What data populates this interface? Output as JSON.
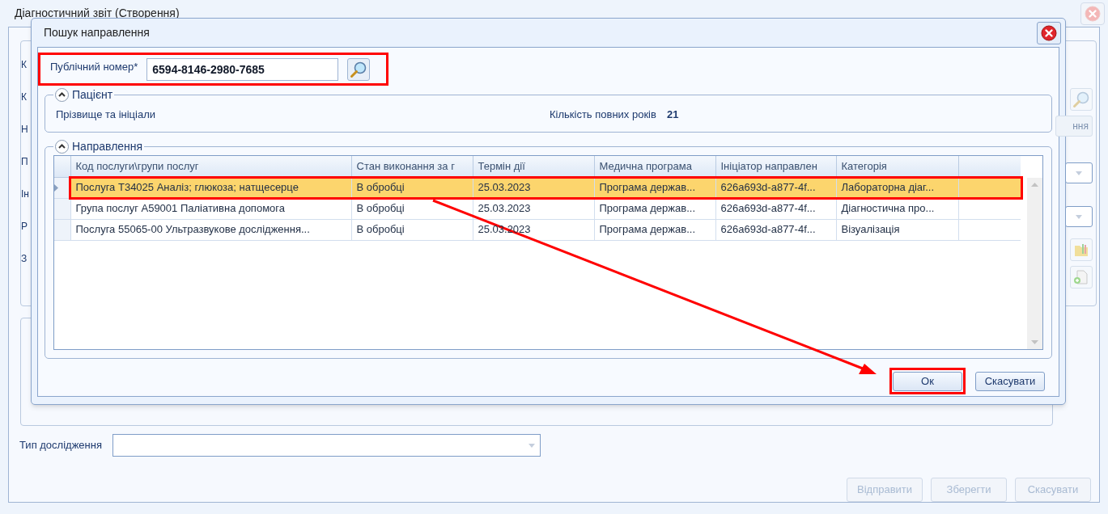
{
  "window": {
    "title": "Діагностичний звіт (Створення)",
    "form_labels": [
      "К",
      "К",
      "Н",
      "П",
      "Ін",
      "Р",
      "З"
    ],
    "hidden_button": "ння",
    "study_type": {
      "label": "Тип дослідження"
    },
    "buttons": [
      {
        "label": "Відправити",
        "disabled": true
      },
      {
        "label": "Зберегти",
        "disabled": true
      },
      {
        "label": "Скасувати",
        "disabled": true
      }
    ]
  },
  "dialog": {
    "title": "Пошук направлення",
    "public_number": {
      "label": "Публічний номер*",
      "value": "6594-8146-2980-7685",
      "highlighted": true
    },
    "patient": {
      "title": "Пацієнт",
      "expanded": true,
      "name_label": "Прізвище та ініціали",
      "age_label": "Кількість повних років",
      "age_value": "21"
    },
    "referrals": {
      "title": "Направлення",
      "expanded": true,
      "columns": [
        "Код послуги\\групи послуг",
        "Стан виконання за г",
        "Термін дії",
        "Медична програма",
        "Ініціатор направлен",
        "Категорія"
      ],
      "rows": [
        {
          "selected": true,
          "highlighted": true,
          "cells": [
            "Послуга Т34025 Аналіз; глюкоза; натщесерце",
            "В обробці",
            "25.03.2023",
            "Програма держав...",
            "626a693d-a877-4f...",
            "Лабораторна діаг..."
          ]
        },
        {
          "selected": false,
          "highlighted": false,
          "cells": [
            "Група послуг А59001 Паліативна допомога",
            "В обробці",
            "25.03.2023",
            "Програма держав...",
            "626a693d-a877-4f...",
            "Діагностична про..."
          ]
        },
        {
          "selected": false,
          "highlighted": false,
          "cells": [
            "Послуга 55065-00 Ультразвукове дослідження...",
            "В обробці",
            "25.03.2023",
            "Програма держав...",
            "626a693d-a877-4f...",
            "Візуалізація"
          ]
        }
      ]
    },
    "buttons": [
      {
        "label": "Ок",
        "highlighted": true
      },
      {
        "label": "Скасувати",
        "highlighted": false
      }
    ]
  }
}
